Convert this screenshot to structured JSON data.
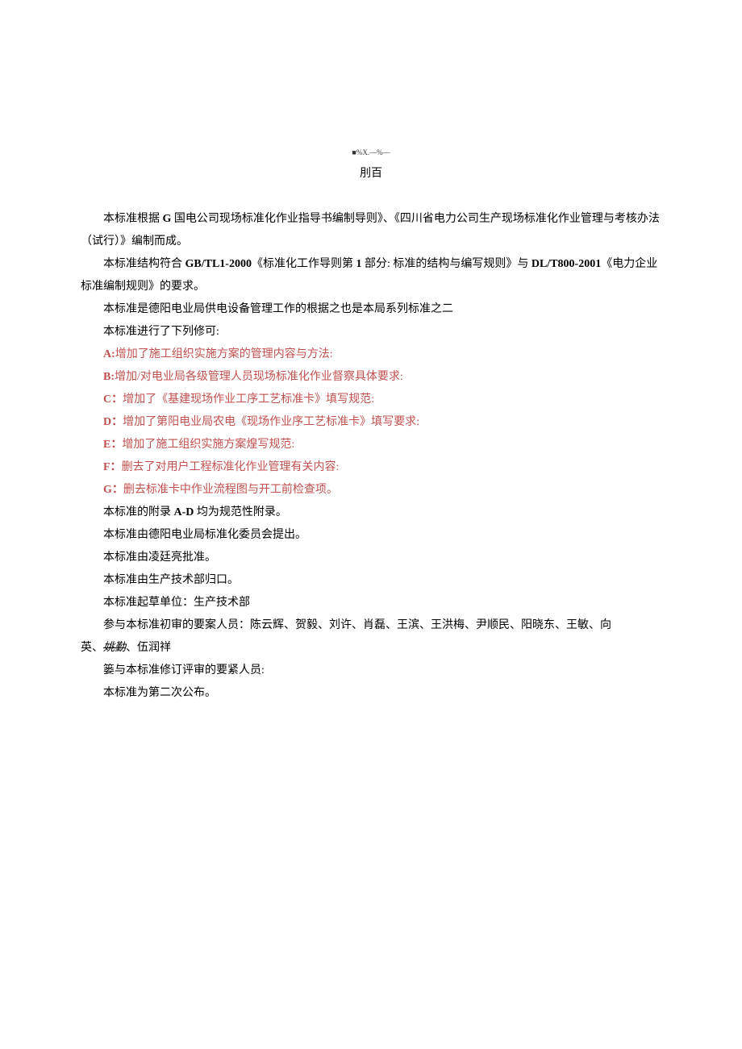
{
  "header": {
    "small": "■%X.—%—",
    "title": "刖百"
  },
  "paragraphs": {
    "p1_pre": "本标准根据 ",
    "p1_bold": "G",
    "p1_post": " 国电公司现场标准化作业指导书编制导则》、《四川省电力公司生产现场标准化作业管理与考核办法（试行）》编制而成。",
    "p2_pre": "本标准结构符合 ",
    "p2_bold1": "GB/TL1-2000",
    "p2_mid": "《标准化工作导则第 ",
    "p2_bold2": "1",
    "p2_mid2": " 部分: 标准的结构与编写规则》与 ",
    "p2_bold3": "DL/T800-2001",
    "p2_post": "《电力企业标准编制规则》的要求。",
    "p3": "本标准是德阳电业局供电设备管理工作的根据之也是本局系列标准之二",
    "p4": "本标准进行了下列修可:",
    "pA_bold": "A:",
    "pA_text": "增加了施工组织实施方案的管理内容与方法:",
    "pB_bold": "B:",
    "pB_text": "增加/对电业局各级管理人员现场标准化作业督察具体要求:",
    "pC_bold": "C：",
    "pC_text": "增加了《基建现场作业工序工艺标准卡》填写规范:",
    "pD_bold": "D：",
    "pD_text": "增加了第阳电业局农电《现场作业序工艺标准卡》填写要求:",
    "pE_bold": "E：",
    "pE_text": "增加了施工组织实施方案煌写规范:",
    "pF_bold": "F：",
    "pF_text": "删去了对用户工程标准化作业管理有关内容:",
    "pG_bold": "G：",
    "pG_text": "删去标准卡中作业流程图与开工前检查项。",
    "p5_pre": "本标准的附录 ",
    "p5_bold": "A-D",
    "p5_post": " 均为规范性附录。",
    "p6": "本标准由德阳电业局标准化委员会提出。",
    "p7": "本标准由凌廷亮批准。",
    "p8": "本标准由生产技术部归口。",
    "p9": "本标准起草单位：生产技术部",
    "p10a": "参与本标准初审的要案人员：陈云辉、贺毅、刘许、肖磊、王滨、王洪梅、尹顺民、阳晓东、王敏、向",
    "p10b_pre": "英、",
    "p10b_strike": "姚勤",
    "p10b_post": "、伍润祥",
    "p11": "篓与本标准修订评审的要紧人员:",
    "p12": "本标准为第二次公布。"
  }
}
